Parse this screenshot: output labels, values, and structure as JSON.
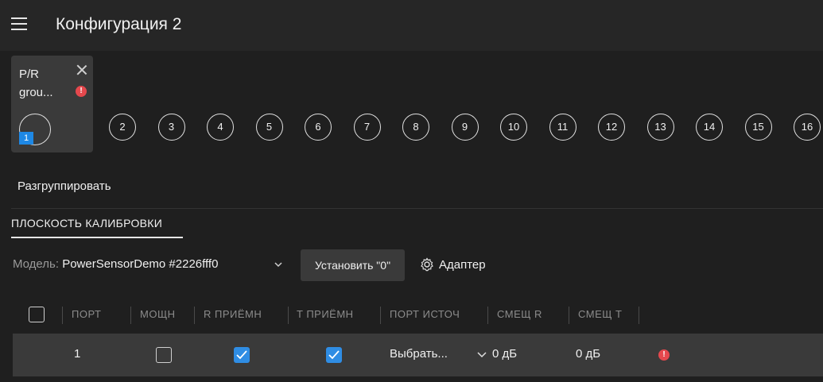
{
  "header": {
    "title": "Конфигурация 2"
  },
  "group": {
    "name_line1": "P/R",
    "name_line2": "grou...",
    "first_port_badge": "1"
  },
  "ports": [
    "2",
    "3",
    "4",
    "5",
    "6",
    "7",
    "8",
    "9",
    "10",
    "11",
    "12",
    "13",
    "14",
    "15",
    "16"
  ],
  "ungroup_label": "Разгруппировать",
  "tab": {
    "label": "ПЛОСКОСТЬ КАЛИБРОВКИ"
  },
  "model": {
    "label": "Модель:",
    "value": "PowerSensorDemo #2226fff0"
  },
  "buttons": {
    "set_zero": "Установить \"0\"",
    "adapter": "Адаптер"
  },
  "table": {
    "columns": [
      "ПОРТ",
      "МОЩН",
      "R ПРИЁМН",
      "T ПРИЁМН",
      "ПОРТ ИСТОЧ",
      "СМЕЩ R",
      "СМЕЩ T"
    ],
    "rows": [
      {
        "port": "1",
        "power": false,
        "r_rx": true,
        "t_rx": true,
        "source": "Выбрать...",
        "offset_r": "0 дБ",
        "offset_t": "0 дБ",
        "error": true
      }
    ]
  },
  "colors": {
    "accent": "#2f8de4",
    "error": "#e5484d",
    "badge": "#1e88e5"
  }
}
